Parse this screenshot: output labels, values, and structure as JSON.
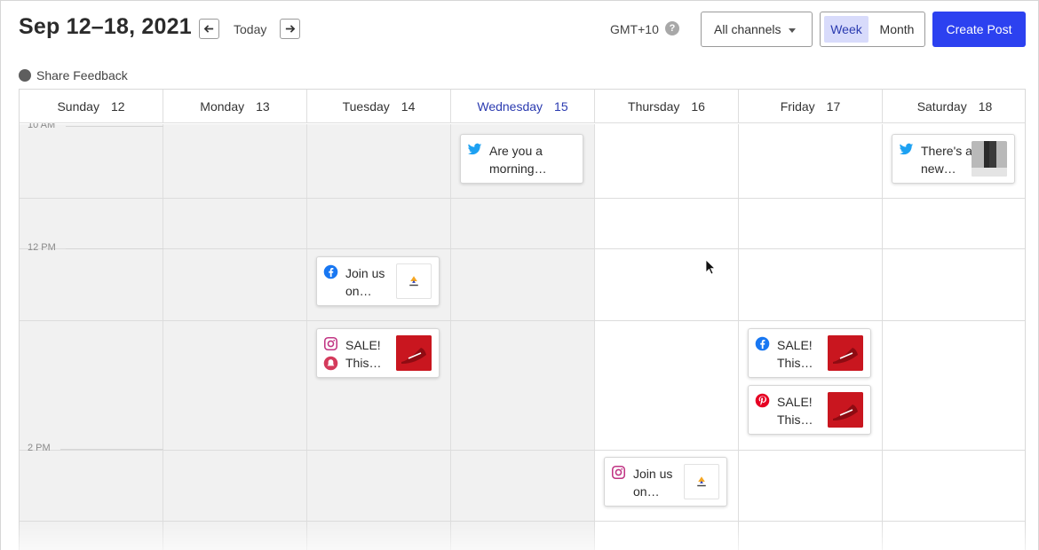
{
  "header": {
    "title": "Sep 12–18, 2021",
    "today_label": "Today",
    "timezone": "GMT+10",
    "help_label": "?",
    "channels_label": "All channels",
    "view_week": "Week",
    "view_month": "Month",
    "create_label": "Create Post"
  },
  "feedback_label": "Share Feedback",
  "colors": {
    "primary": "#2c41f0",
    "active_day": "#2b3bb0",
    "week_toggle_bg": "#d8dbfb",
    "past_column_bg": "#f1f1f1",
    "twitter": "#1da1f2",
    "facebook": "#1877f2",
    "instagram": "#c13584",
    "pinterest": "#e60023"
  },
  "days": [
    {
      "name": "Sunday",
      "num": "12"
    },
    {
      "name": "Monday",
      "num": "13"
    },
    {
      "name": "Tuesday",
      "num": "14"
    },
    {
      "name": "Wednesday",
      "num": "15"
    },
    {
      "name": "Thursday",
      "num": "16"
    },
    {
      "name": "Friday",
      "num": "17"
    },
    {
      "name": "Saturday",
      "num": "18"
    }
  ],
  "times": [
    "10 AM",
    "12 PM",
    "2 PM"
  ],
  "posts": [
    {
      "line1": "Are you a",
      "line2": "morning…",
      "network": "twitter-icon"
    },
    {
      "line1": "There's a",
      "line2": "new…",
      "network": "twitter-icon"
    },
    {
      "line1": "Join us",
      "line2": "on…",
      "network": "facebook-icon"
    },
    {
      "line1": "SALE!",
      "line2": "This…",
      "network": "instagram-icon"
    },
    {
      "line1": "SALE!",
      "line2": "This…",
      "network": "facebook-icon"
    },
    {
      "line1": "SALE!",
      "line2": "This…",
      "network": "pinterest-icon"
    },
    {
      "line1": "Join us",
      "line2": "on…",
      "network": "instagram-icon"
    }
  ]
}
